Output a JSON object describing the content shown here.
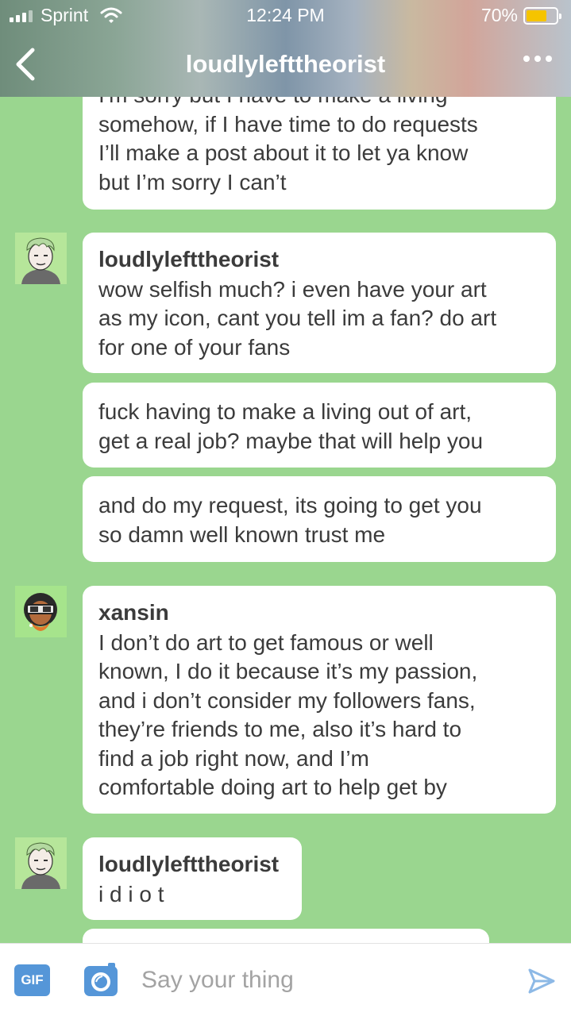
{
  "status": {
    "carrier": "Sprint",
    "time": "12:24 PM",
    "battery": "70%",
    "battery_level": 0.7
  },
  "header": {
    "title": "loudlylefttheorist"
  },
  "messages": [
    {
      "author": "",
      "lines": [
        "I'm sorry but I have to make a living",
        "somehow, if I have time to do requests",
        "I’ll make a post about it to let ya know",
        "but I’m sorry I can’t"
      ]
    },
    {
      "author": "loudlylefttheorist",
      "lines": [
        "wow selfish much? i even have your art",
        "as my icon, cant you tell im a fan? do art",
        "for one of your fans"
      ]
    },
    {
      "author": "",
      "lines": [
        "fuck having to make a living out of art,",
        "get a real job? maybe that will help you"
      ]
    },
    {
      "author": "",
      "lines": [
        "and do my request, its going to get you",
        "so damn well known trust me"
      ]
    },
    {
      "author": "xansin",
      "lines": [
        "I don’t do art to get famous or well",
        "known, I do it because it’s my passion,",
        "and i don’t consider my followers fans,",
        "they’re friends to me, also it’s hard to",
        "find a job right now, and I’m",
        "comfortable doing art to help get by"
      ]
    },
    {
      "author": "loudlylefttheorist",
      "lines": [
        "i d i o t"
      ]
    }
  ],
  "composer": {
    "gif_label": "GIF",
    "placeholder": "Say your thing"
  },
  "colors": {
    "chat_bg": "#9ad68f",
    "bubble": "#ffffff",
    "accent": "#5596d8"
  }
}
